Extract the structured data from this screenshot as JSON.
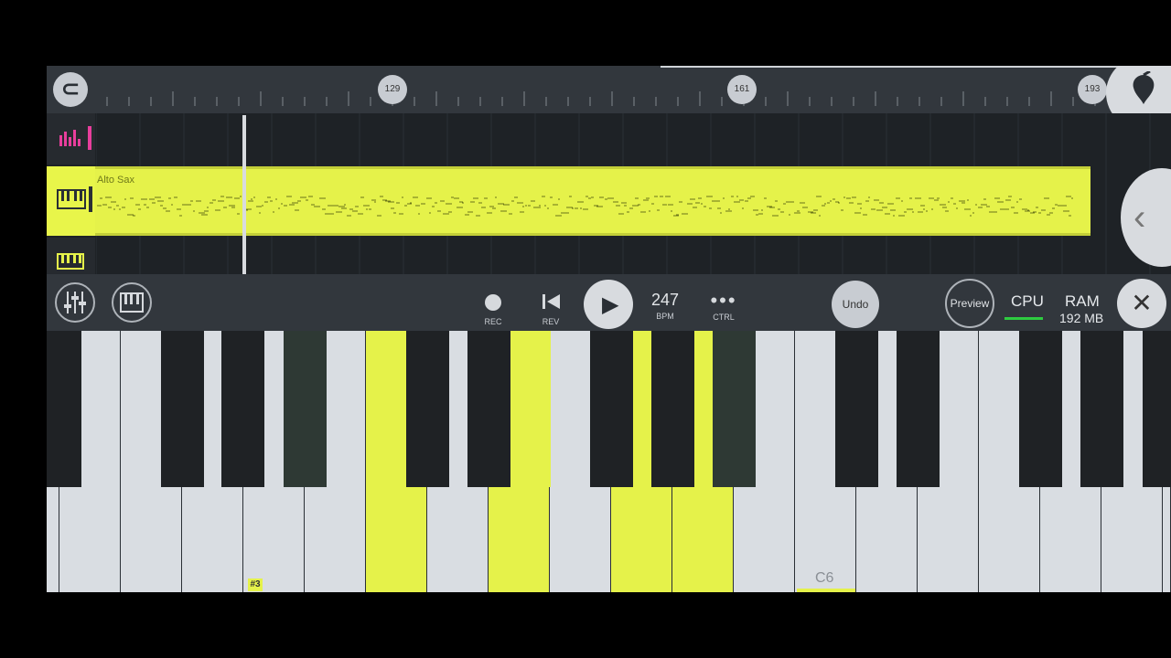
{
  "ruler": {
    "markers": [
      "129",
      "161",
      "193"
    ]
  },
  "playlist": {
    "clip_name": "Alto Sax"
  },
  "toolbar": {
    "rec_label": "REC",
    "rev_label": "REV",
    "bpm_value": "247",
    "bpm_label": "BPM",
    "ctrl_label": "CTRL",
    "undo_label": "Undo",
    "preview_label": "Preview",
    "cpu_label": "CPU",
    "ram_label": "RAM",
    "ram_value": "192 MB"
  },
  "keyboard": {
    "octave_tag": "#3",
    "c6_label": "C6"
  },
  "colors": {
    "accent": "#e5f24a",
    "pink": "#e83e9c",
    "cpu_green": "#2ecc40",
    "bg": "#2a2f35"
  },
  "icons": [
    "magnet-icon",
    "fl-fruit-logo-icon",
    "mixer-icon",
    "piano-icon",
    "record-icon",
    "rewind-icon",
    "play-icon",
    "more-dots-icon",
    "close-icon",
    "chevron-left-icon"
  ]
}
